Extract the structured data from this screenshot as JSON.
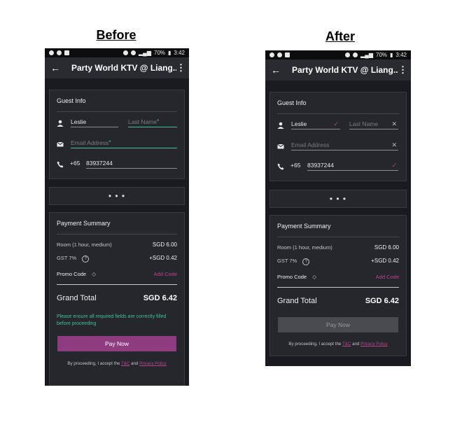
{
  "captions": {
    "before": "Before",
    "after": "After"
  },
  "status": {
    "battery": "70%",
    "time": "3:42"
  },
  "appbar": {
    "title": "Party World KTV @ Liang..."
  },
  "guest": {
    "title": "Guest Info",
    "first_name": "Leslie",
    "last_name_placeholder": "Last Name",
    "email_placeholder": "Email Address",
    "country_code": "+65",
    "phone": "83937244",
    "required_star": "*"
  },
  "ellipsis": "• • •",
  "summary": {
    "title": "Payment Summary",
    "room_label": "Room (1 hour, medium)",
    "room_value": "SGD 6.00",
    "gst_label": "GST 7%",
    "gst_value": "+SGD 0.42",
    "promo_label": "Promo Code",
    "add_code": "Add Code",
    "grand_label": "Grand Total",
    "grand_value": "SGD 6.42"
  },
  "before": {
    "warning": "Please ensure all required fields are correctly filled before proceeding",
    "pay_button": "Pay Now"
  },
  "after": {
    "pay_button": "Pay Now"
  },
  "terms": {
    "prefix": "By proceeding, I accept the",
    "tc": "T&C",
    "and": "and",
    "privacy": "Privacy Policy"
  },
  "colors": {
    "accent": "#8e3b80",
    "teal": "#3fbf9f",
    "disabled": "#4a4b50"
  }
}
